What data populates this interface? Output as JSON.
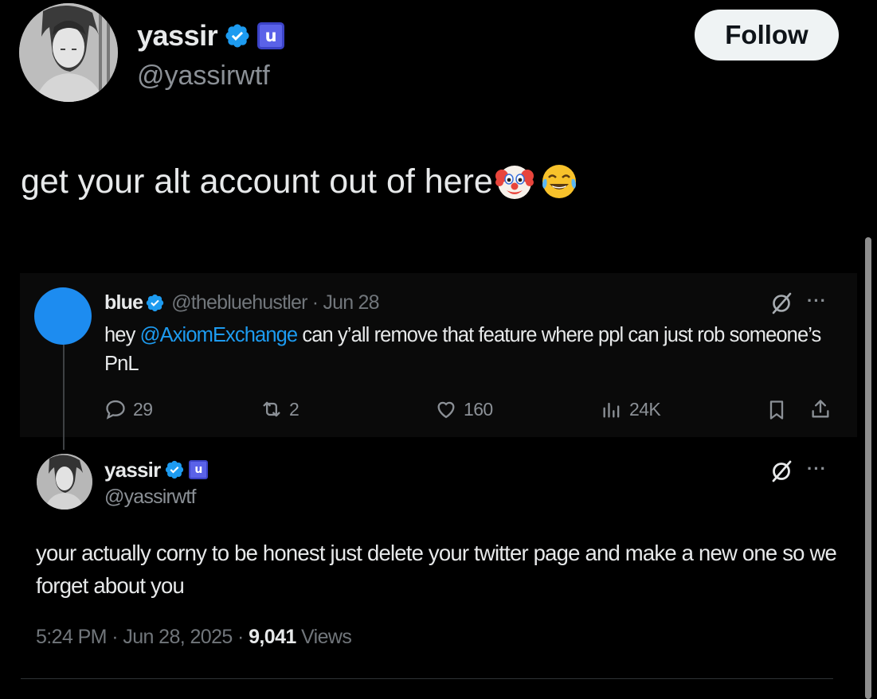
{
  "author": {
    "display_name": "yassir",
    "handle": "@yassirwtf",
    "affiliate_badge": "u",
    "follow_label": "Follow"
  },
  "tweet": {
    "text": "get your alt account out of here",
    "emojis": [
      "clown-face",
      "face-with-tears-of-joy"
    ]
  },
  "quoted_parent": {
    "name": "blue",
    "meta": "@thebluehustler · Jun 28",
    "text_before": "hey ",
    "mention": "@AxiomExchange",
    "text_after": " can y’all remove that feature where ppl can just rob someone’s PnL",
    "actions": {
      "replies": "29",
      "reposts": "2",
      "likes": "160",
      "views": "24K"
    }
  },
  "reply": {
    "display_name": "yassir",
    "handle": "@yassirwtf",
    "affiliate_badge": "u",
    "text": "your actually corny to be honest just delete your twitter page and make a new one so we forget about you",
    "timestamp": "5:24 PM · Jun 28, 2025 · ",
    "views_count": "9,041",
    "views_label": " Views"
  },
  "colors": {
    "background": "#000000",
    "accent_blue": "#1d9bf0",
    "muted_text": "#71767b",
    "affiliate_purple": "#5a62e8"
  }
}
